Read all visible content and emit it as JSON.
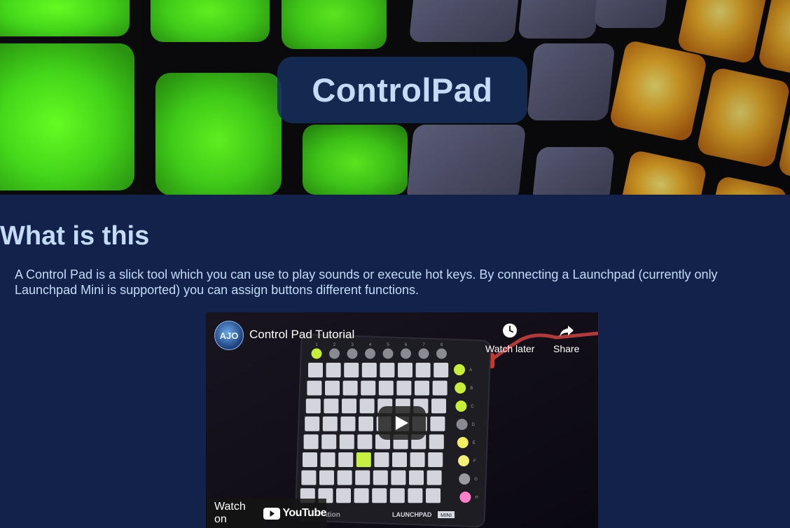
{
  "hero": {
    "title": "ControlPad"
  },
  "about": {
    "heading": "What is this",
    "description": "A Control Pad is a slick tool which you can use to play sounds or execute hot keys. By connecting a Launchpad (currently only Launchpad Mini is supported) you can assign buttons different functions."
  },
  "video": {
    "title": "Control Pad Tutorial",
    "channel_avatar": "AJO",
    "watch_later_label": "Watch later",
    "share_label": "Share",
    "watch_on_label": "Watch on",
    "youtube_label": "YouTube",
    "device_brand": "ation",
    "device_model": "LAUNCHPAD",
    "device_model_badge": "MINI",
    "column_labels": [
      "1",
      "2",
      "3",
      "4",
      "5",
      "6",
      "7",
      "8"
    ],
    "row_labels": [
      "A",
      "B",
      "C",
      "D",
      "E",
      "F",
      "G",
      "H"
    ],
    "icons": {
      "watch_later": "clock-icon",
      "share": "share-arrow-icon",
      "play": "play-icon"
    }
  },
  "colors": {
    "page_background": "#13224a",
    "heading_text": "#c4dcfa",
    "title_box": "#162e5c",
    "pad_green": "#5ee02c",
    "pad_gray": "#5a5a78",
    "pad_amber": "#f0b02a",
    "youtube_red": "#ff0000"
  }
}
